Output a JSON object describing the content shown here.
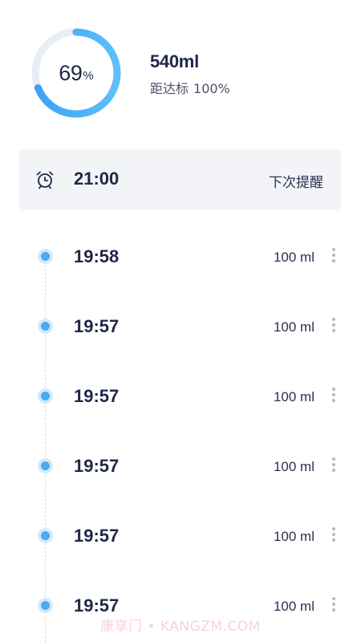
{
  "summary": {
    "progress": 69,
    "progress_value": "69",
    "progress_unit": "%",
    "total": "540ml",
    "goal_label": "距达标",
    "goal_value": "100%",
    "colors": {
      "ring_track": "#e9eef4",
      "ring_start": "#3aa2f5",
      "ring_end": "#5cc0fb"
    }
  },
  "reminder": {
    "icon": "alarm-clock-icon",
    "time": "21:00",
    "label": "下次提醒"
  },
  "log": {
    "accent": "#4aaaf4",
    "items": [
      {
        "time": "19:58",
        "amount": "100 ml"
      },
      {
        "time": "19:57",
        "amount": "100 ml"
      },
      {
        "time": "19:57",
        "amount": "100 ml"
      },
      {
        "time": "19:57",
        "amount": "100 ml"
      },
      {
        "time": "19:57",
        "amount": "100 ml"
      },
      {
        "time": "19:57",
        "amount": "100 ml"
      }
    ]
  },
  "watermark": "康享门 • KANGZM.COM"
}
